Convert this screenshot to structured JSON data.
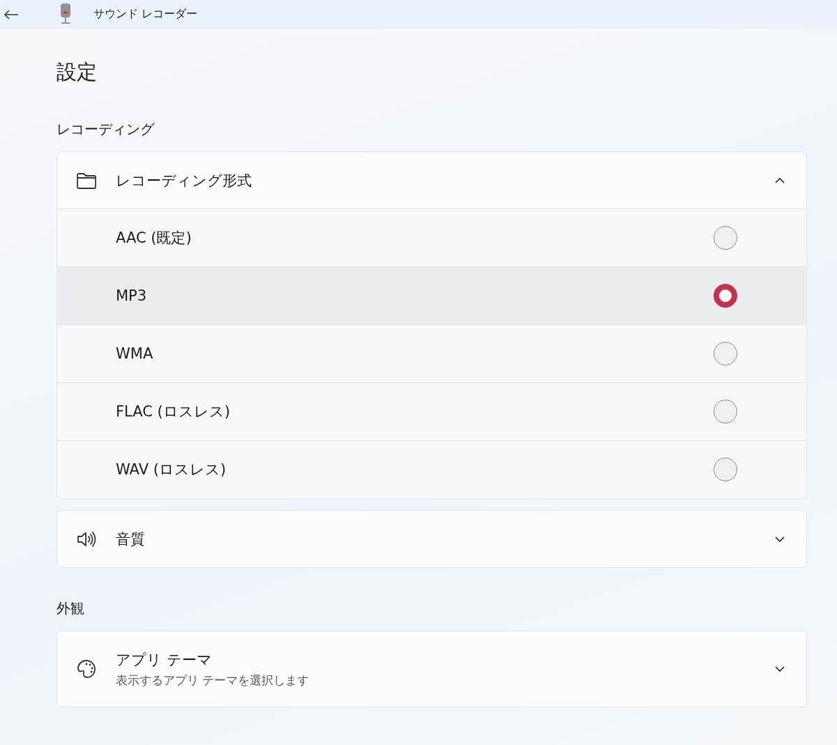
{
  "window": {
    "title": "サウンド レコーダー"
  },
  "page": {
    "title": "設定"
  },
  "sections": [
    {
      "heading": "レコーディング",
      "cards": [
        {
          "title": "レコーディング形式",
          "expanded": true,
          "options": [
            {
              "label": "AAC (既定)",
              "selected": false
            },
            {
              "label": "MP3",
              "selected": true
            },
            {
              "label": "WMA",
              "selected": false
            },
            {
              "label": "FLAC (ロスレス)",
              "selected": false
            },
            {
              "label": "WAV (ロスレス)",
              "selected": false
            }
          ]
        },
        {
          "title": "音質",
          "expanded": false
        }
      ]
    },
    {
      "heading": "外観",
      "cards": [
        {
          "title": "アプリ テーマ",
          "subtitle": "表示するアプリ テーマを選択します",
          "expanded": false
        }
      ]
    }
  ]
}
